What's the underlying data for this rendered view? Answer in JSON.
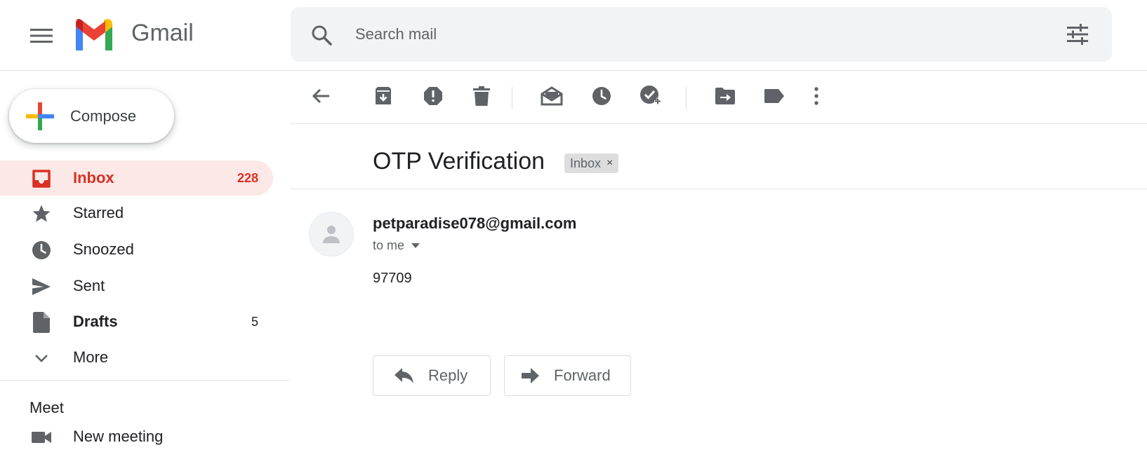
{
  "header": {
    "app_name": "Gmail",
    "search": {
      "placeholder": "Search mail"
    },
    "icons": [
      "menu-icon",
      "gmail-logo",
      "search-icon",
      "search-options-icon"
    ]
  },
  "sidebar": {
    "compose_label": "Compose",
    "items": [
      {
        "label": "Inbox",
        "count": "228",
        "icon": "inbox-icon",
        "active": true
      },
      {
        "label": "Starred",
        "count": "",
        "icon": "star-icon"
      },
      {
        "label": "Snoozed",
        "count": "",
        "icon": "clock-icon"
      },
      {
        "label": "Sent",
        "count": "",
        "icon": "send-icon"
      },
      {
        "label": "Drafts",
        "count": "5",
        "icon": "draft-icon",
        "bold": true
      },
      {
        "label": "More",
        "count": "",
        "icon": "chevron-down-icon"
      }
    ],
    "meet": {
      "heading": "Meet",
      "new_meeting_label": "New meeting"
    }
  },
  "toolbar": {
    "icons": [
      "back-icon",
      "archive-icon",
      "report-spam-icon",
      "delete-icon",
      "mark-unread-icon",
      "snooze-icon",
      "add-task-icon",
      "move-to-icon",
      "label-icon",
      "more-vert-icon"
    ]
  },
  "message": {
    "subject": "OTP Verification",
    "label_chip": "Inbox",
    "label_chip_close": "×",
    "sender": "petparadise078@gmail.com",
    "recipients": "to me",
    "body": "97709",
    "reply_label": "Reply",
    "forward_label": "Forward"
  },
  "colors": {
    "active_accent": "#d93025",
    "active_bg": "#fce8e6",
    "icon_gray": "#5f6368",
    "search_bg": "#f1f3f4"
  }
}
